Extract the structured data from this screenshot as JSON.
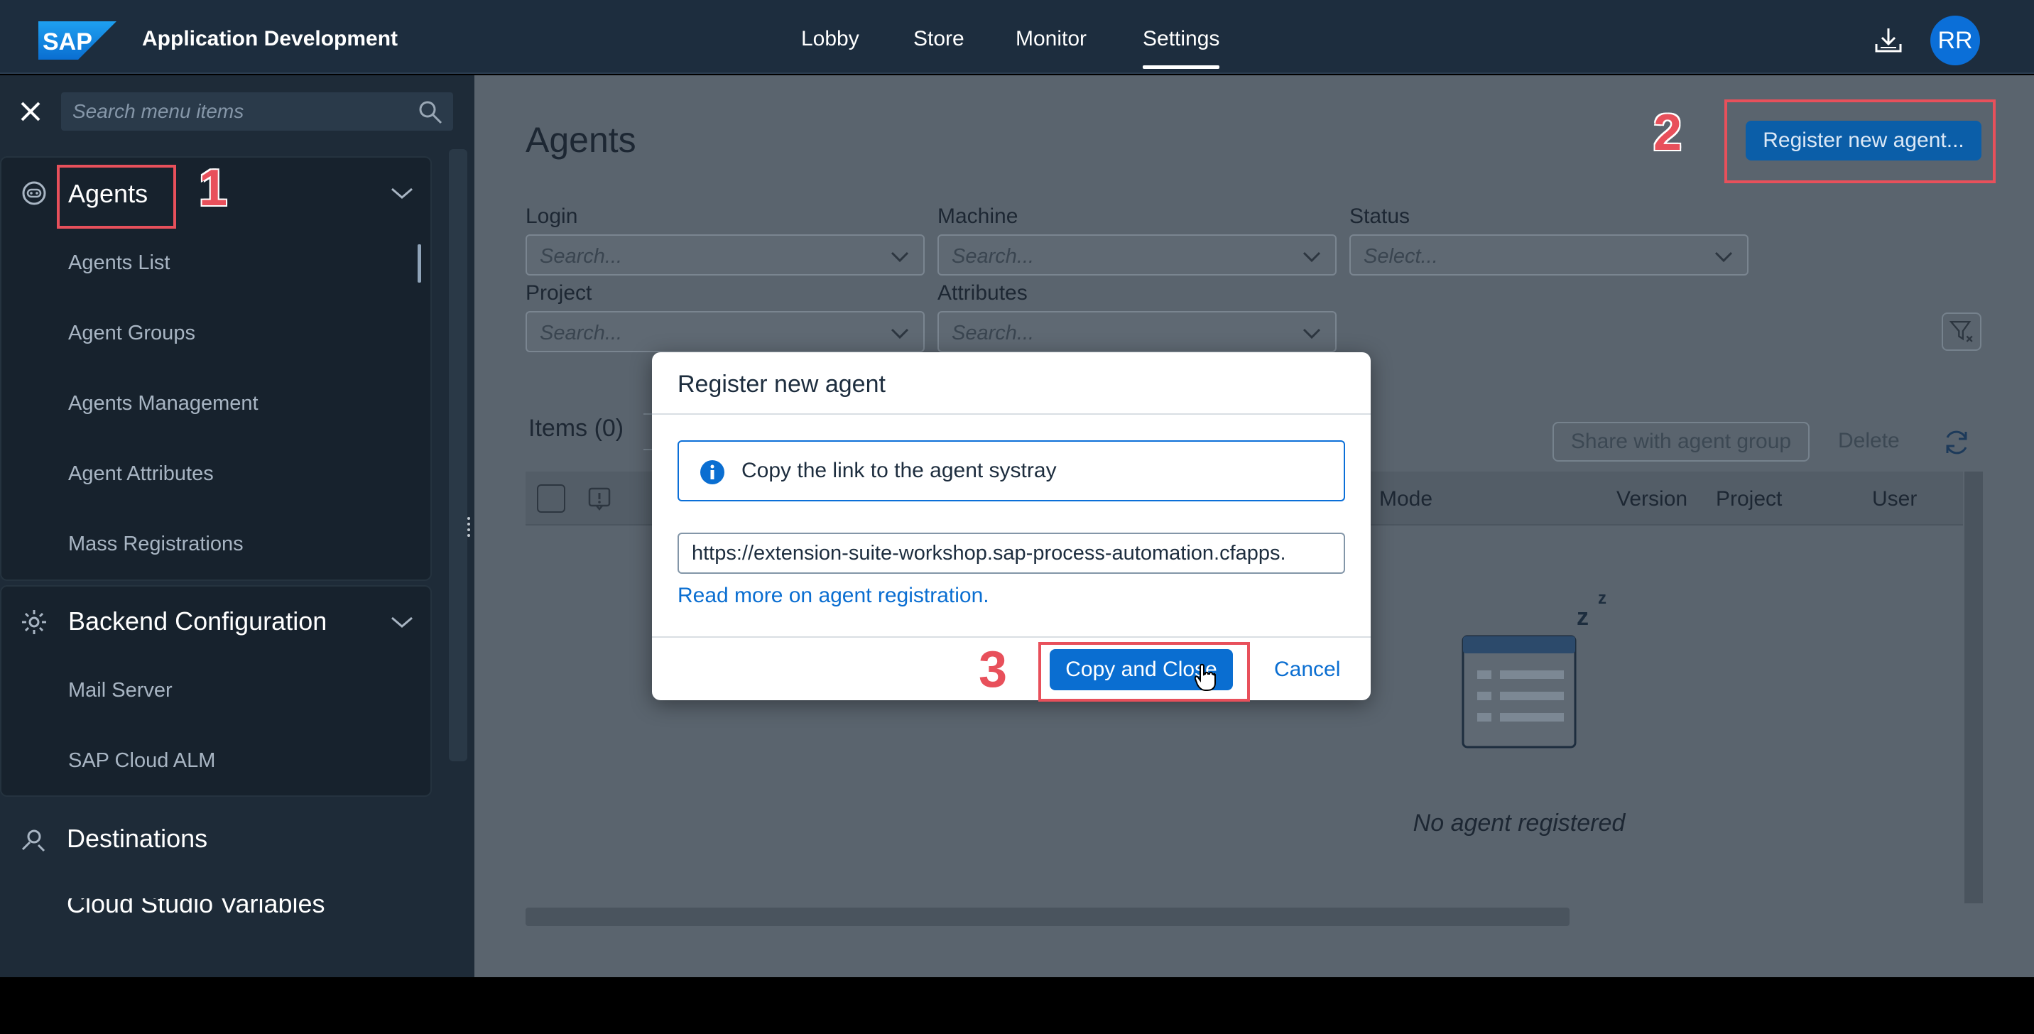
{
  "shell": {
    "logo": "SAP",
    "app_title": "Application Development",
    "nav": [
      {
        "label": "Lobby"
      },
      {
        "label": "Store"
      },
      {
        "label": "Monitor"
      },
      {
        "label": "Settings",
        "active": true
      }
    ],
    "download_icon": "download-icon",
    "avatar_initials": "RR"
  },
  "sidebar": {
    "close_icon": "close-icon",
    "search_placeholder": "Search menu items",
    "search_icon": "search-icon",
    "groups": [
      {
        "label": "Agents",
        "icon": "robot-icon",
        "expanded": true,
        "items": [
          "Agents List",
          "Agent Groups",
          "Agents Management",
          "Agent Attributes",
          "Mass Registrations"
        ]
      },
      {
        "label": "Backend Configuration",
        "icon": "gear-icon",
        "expanded": true,
        "items": [
          "Mail Server",
          "SAP Cloud ALM"
        ]
      }
    ],
    "destinations_label": "Destinations",
    "destinations_icon": "destinations-icon",
    "cut_off_label": "Cloud Studio Variables"
  },
  "main": {
    "title": "Agents",
    "register_button": "Register new agent...",
    "filters": {
      "login": {
        "label": "Login",
        "placeholder": "Search..."
      },
      "machine": {
        "label": "Machine",
        "placeholder": "Search..."
      },
      "status": {
        "label": "Status",
        "placeholder": "Select..."
      },
      "project": {
        "label": "Project",
        "placeholder": "Search..."
      },
      "attributes": {
        "label": "Attributes",
        "placeholder": "Search..."
      }
    },
    "items_label": "Items (0)",
    "share_button": "Share with agent group",
    "delete_button": "Delete",
    "refresh_icon": "refresh-icon",
    "columns": [
      "Mode",
      "Version",
      "Project",
      "User"
    ],
    "empty_text": "No agent registered"
  },
  "dialog": {
    "title": "Register new agent",
    "info_text": "Copy the link to the agent systray",
    "link_value": "https://extension-suite-workshop.sap-process-automation.cfapps.",
    "read_more": "Read more on agent registration.",
    "copy_button": "Copy and Close",
    "cancel_button": "Cancel"
  },
  "annotations": {
    "step1": "1",
    "step2": "2",
    "step3": "3",
    "color": "#e8505b"
  },
  "colors": {
    "shell_bg": "#1d2d3e",
    "accent": "#0a6ed1"
  }
}
